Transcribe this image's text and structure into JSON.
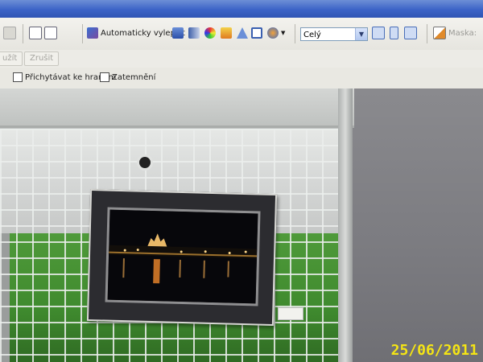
{
  "toolbar": {
    "auto_enhance_label": "Automaticky vylepšit",
    "zoom_select_value": "Celý",
    "mask_label": "Maska:"
  },
  "row2": {
    "button_1_label": "užít",
    "button_2_label": "Zrušit"
  },
  "row3": {
    "snap_checkbox_label": "Přichytávat ke hranám",
    "darken_checkbox_label": "Zatemnění"
  },
  "photo": {
    "date_stamp": "25/06/2011"
  },
  "colors": {
    "title_bar": "#3c63c7",
    "toolbar_bg": "#ecebe6",
    "grass": "#3f8a2e",
    "date_stamp": "#f5e514"
  },
  "icons": [
    "undo-icon",
    "copy-icon",
    "paste-icon",
    "auto-enhance-icon",
    "levels-icon",
    "contrast-icon",
    "color-icon",
    "brightness-icon",
    "sharpen-icon",
    "crop-icon",
    "effects-icon",
    "fit-window-icon",
    "fit-height-icon",
    "zoom-icon",
    "mask-icon"
  ]
}
